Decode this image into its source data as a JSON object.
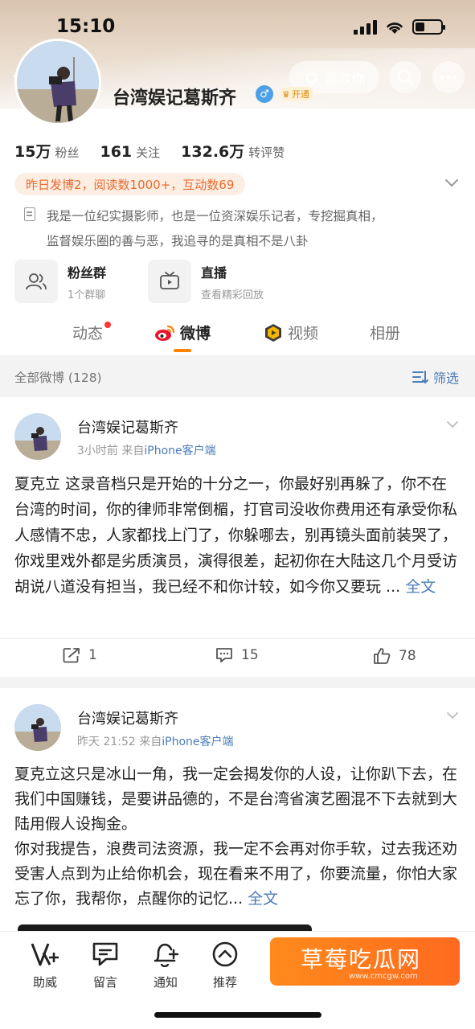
{
  "status_bar": {
    "time": "15:10"
  },
  "header": {
    "like_label": "喜欢你",
    "name": "台湾娱记葛斯齐",
    "vip_label": "开通"
  },
  "stats": [
    {
      "value": "15万",
      "label": "粉丝"
    },
    {
      "value": "161",
      "label": "关注"
    },
    {
      "value": "132.6万",
      "label": "转评赞"
    }
  ],
  "activity": "昨日发博2，阅读数1000+，互动数69",
  "bio": {
    "line1": "我是一位纪实摄影师，也是一位资深娱乐记者，专挖掘真相，",
    "line2": "监督娱乐圈的善与恶，我追寻的是真相不是八卦"
  },
  "features": [
    {
      "title": "粉丝群",
      "sub": "1个群聊"
    },
    {
      "title": "直播",
      "sub": "查看精彩回放"
    }
  ],
  "tabs": [
    {
      "label": "动态"
    },
    {
      "label": "微博"
    },
    {
      "label": "视频"
    },
    {
      "label": "相册"
    }
  ],
  "filter": {
    "count": "全部微博 (128)",
    "button": "筛选"
  },
  "posts": [
    {
      "author": "台湾娱记葛斯齐",
      "time": "3小时前",
      "from": "来自",
      "source": "iPhone客户端",
      "text": "夏克立 这录音档只是开始的十分之一，你最好别再躲了，你不在台湾的时间，你的律师非常倒楣，打官司没收你费用还有承受你私人感情不忠，人家都找上门了，你躲哪去，别再镜头面前装哭了，你戏里戏外都是劣质演员，演得很差，起初你在大陆这几个月受访胡说八道没有担当，我已经不和你计较，如今你又要玩 ...",
      "more": "全文",
      "reposts": "1",
      "comments": "15",
      "likes": "78"
    },
    {
      "author": "台湾娱记葛斯齐",
      "time": "昨天 21:52",
      "from": "来自",
      "source": "iPhone客户端",
      "para1": "夏克立这只是冰山一角，我一定会揭发你的人设，让你趴下去，在我们中国赚钱，是要讲品德的，不是台湾省演艺圈混不下去就到大陆用假人设掏金。",
      "para2": "你对我提告，浪费司法资源，我一定不会再对你手软，过去我还劝受害人点到为止给你机会，现在看来不用了，你要流量，你怕大家忘了你，我帮你，点醒你的记忆...",
      "more": "全文"
    }
  ],
  "bottom_nav": [
    {
      "label": "助威"
    },
    {
      "label": "留言"
    },
    {
      "label": "通知"
    },
    {
      "label": "推荐"
    }
  ],
  "watermark": {
    "title": "草莓吃瓜网",
    "url": "www.cmcgw.com"
  },
  "colors": {
    "accent": "#ff8200",
    "link": "#4b7db8",
    "activity": "#e96a2d"
  }
}
